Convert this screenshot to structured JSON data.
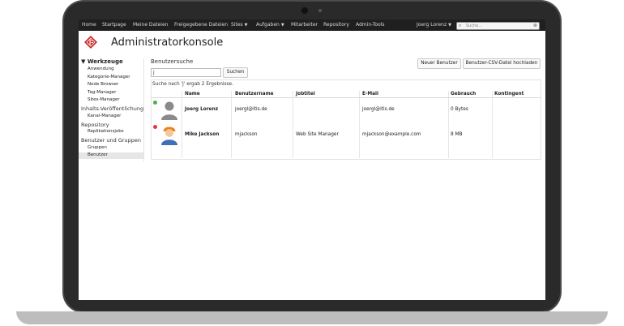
{
  "navbar": {
    "items": [
      "Home",
      "Startpage",
      "Meine Dateien",
      "Freigegebene Dateien",
      "Sites",
      "Aufgaben",
      "Mitarbeiter",
      "Repository",
      "Admin-Tools"
    ],
    "user": "Joerg Lorenz",
    "search_placeholder": "Suche..."
  },
  "header": {
    "title": "Administratorkonsole"
  },
  "sidebar": {
    "groups": [
      {
        "label": "Werkzeuge",
        "items": [
          "Anwendung",
          "Kategorie-Manager",
          "Node Browser",
          "Tag-Manager",
          "Sites-Manager"
        ]
      },
      {
        "label": "Inhalts-Veröffentlichung",
        "items": [
          "Kanal-Manager"
        ]
      },
      {
        "label": "Repository",
        "items": [
          "Replikationsjobs"
        ]
      },
      {
        "label": "Benutzer und Gruppen",
        "items": [
          "Gruppen",
          "Benutzer"
        ]
      }
    ],
    "active_item": "Benutzer"
  },
  "main": {
    "section_title": "Benutzersuche",
    "query_value": "j",
    "search_button": "Suchen",
    "new_user_button": "Neuer Benutzer",
    "upload_button": "Benutzer-CSV-Datei hochladen",
    "result_message": "Suche nach 'j' ergab 2 Ergebnisse.",
    "columns": [
      "Name",
      "Benutzername",
      "Jobtitel",
      "E-Mail",
      "Gebrauch",
      "Kontingent"
    ],
    "rows": [
      {
        "name": "Joerg Lorenz",
        "username": "joergl@itis.de",
        "jobtitle": "",
        "email": "joergl@itis.de",
        "usage": "0 Bytes",
        "quota": "",
        "status_color": "#4caf50"
      },
      {
        "name": "Mike Jackson",
        "username": "mjackson",
        "jobtitle": "Web Site Manager",
        "email": "mjackson@example.com",
        "usage": "8 MB",
        "quota": "",
        "status_color": "#e53935"
      }
    ]
  },
  "colors": {
    "navbar": "#1f1f1f",
    "logo_red": "#c62828",
    "avatar_blue": "#3f6fb5",
    "avatar_helmet": "#ef7f1a"
  }
}
